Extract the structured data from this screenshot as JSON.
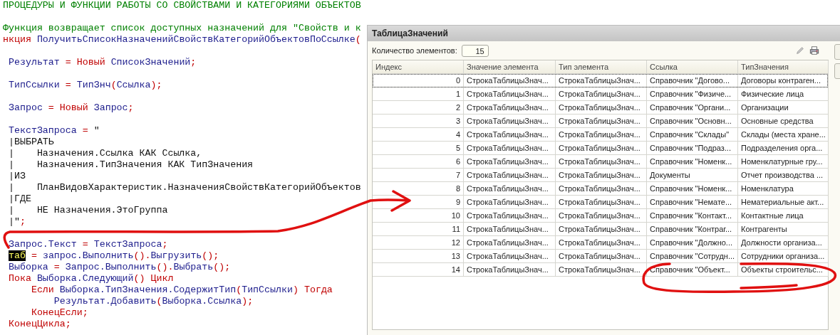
{
  "editor": {
    "lines": [
      {
        "kind": "code",
        "tokens": [
          {
            "kind": "comment",
            "text": "ПРОЦЕДУРЫ И ФУНКЦИИ РАБОТЫ СО СВОЙСТВАМИ И КАТЕГОРИЯМИ ОБЪЕКТОВ"
          }
        ]
      },
      {
        "kind": "blank"
      },
      {
        "kind": "code",
        "tokens": [
          {
            "kind": "comment",
            "text": "Функция возвращает список доступных назначений для \"Свойств и к"
          }
        ]
      },
      {
        "kind": "code",
        "tokens": [
          {
            "kind": "kw",
            "text": "нкция "
          },
          {
            "kind": "id",
            "text": "ПолучитьСписокНазначенийСвойствКатегорийОбъектовПоСсылке"
          },
          {
            "kind": "op",
            "text": "("
          }
        ]
      },
      {
        "kind": "blank"
      },
      {
        "kind": "code",
        "tokens": [
          {
            "kind": "id",
            "text": " Результат "
          },
          {
            "kind": "op",
            "text": "= "
          },
          {
            "kind": "kw",
            "text": "Новый "
          },
          {
            "kind": "id",
            "text": "СписокЗначений"
          },
          {
            "kind": "op",
            "text": ";"
          }
        ]
      },
      {
        "kind": "blank"
      },
      {
        "kind": "code",
        "tokens": [
          {
            "kind": "id",
            "text": " ТипСсылки "
          },
          {
            "kind": "op",
            "text": "= "
          },
          {
            "kind": "id",
            "text": "ТипЗнч"
          },
          {
            "kind": "op",
            "text": "("
          },
          {
            "kind": "id",
            "text": "Ссылка"
          },
          {
            "kind": "op",
            "text": ");"
          }
        ]
      },
      {
        "kind": "blank"
      },
      {
        "kind": "code",
        "tokens": [
          {
            "kind": "id",
            "text": " Запрос "
          },
          {
            "kind": "op",
            "text": "= "
          },
          {
            "kind": "kw",
            "text": "Новый "
          },
          {
            "kind": "id",
            "text": "Запрос"
          },
          {
            "kind": "op",
            "text": ";"
          }
        ]
      },
      {
        "kind": "blank"
      },
      {
        "kind": "code",
        "tokens": [
          {
            "kind": "id",
            "text": " ТекстЗапроса "
          },
          {
            "kind": "op",
            "text": "= "
          },
          {
            "kind": "str",
            "text": "\""
          }
        ]
      },
      {
        "kind": "code",
        "tokens": [
          {
            "kind": "str",
            "text": " |ВЫБРАТЬ"
          }
        ]
      },
      {
        "kind": "code",
        "tokens": [
          {
            "kind": "str",
            "text": " |    Назначения.Ссылка КАК Ссылка,"
          }
        ]
      },
      {
        "kind": "code",
        "tokens": [
          {
            "kind": "str",
            "text": " |    Назначения.ТипЗначения КАК ТипЗначения"
          }
        ]
      },
      {
        "kind": "code",
        "tokens": [
          {
            "kind": "str",
            "text": " |ИЗ"
          }
        ]
      },
      {
        "kind": "code",
        "tokens": [
          {
            "kind": "str",
            "text": " |    ПланВидовХарактеристик.НазначенияСвойствКатегорийОбъектов"
          }
        ]
      },
      {
        "kind": "code",
        "tokens": [
          {
            "kind": "str",
            "text": " |ГДЕ"
          }
        ]
      },
      {
        "kind": "code",
        "tokens": [
          {
            "kind": "str",
            "text": " |    НЕ Назначения.ЭтоГруппа"
          }
        ]
      },
      {
        "kind": "code",
        "tokens": [
          {
            "kind": "str",
            "text": " |\""
          },
          {
            "kind": "op",
            "text": ";"
          }
        ]
      },
      {
        "kind": "blank"
      },
      {
        "kind": "code",
        "tokens": [
          {
            "kind": "id",
            "text": " Запрос.Текст "
          },
          {
            "kind": "op",
            "text": "= "
          },
          {
            "kind": "id",
            "text": "ТекстЗапроса"
          },
          {
            "kind": "op",
            "text": ";"
          }
        ]
      },
      {
        "kind": "code",
        "tokens": [
          {
            "kind": "hl",
            "text": "таб"
          },
          {
            "kind": "op",
            "text": " = "
          },
          {
            "kind": "id",
            "text": "запрос.Выполнить"
          },
          {
            "kind": "op",
            "text": "()."
          },
          {
            "kind": "id",
            "text": "Выгрузить"
          },
          {
            "kind": "op",
            "text": "();"
          }
        ]
      },
      {
        "kind": "code",
        "tokens": [
          {
            "kind": "id",
            "text": " Выборка "
          },
          {
            "kind": "op",
            "text": "= "
          },
          {
            "kind": "id",
            "text": "Запрос.Выполнить"
          },
          {
            "kind": "op",
            "text": "()."
          },
          {
            "kind": "id",
            "text": "Выбрать"
          },
          {
            "kind": "op",
            "text": "();"
          }
        ]
      },
      {
        "kind": "code",
        "tokens": [
          {
            "kind": "kw",
            "text": " Пока "
          },
          {
            "kind": "id",
            "text": "Выборка.Следующий"
          },
          {
            "kind": "op",
            "text": "() "
          },
          {
            "kind": "kw",
            "text": "Цикл"
          }
        ]
      },
      {
        "kind": "code",
        "tokens": [
          {
            "kind": "kw",
            "text": "     Если "
          },
          {
            "kind": "id",
            "text": "Выборка.ТипЗначения.СодержитТип"
          },
          {
            "kind": "op",
            "text": "("
          },
          {
            "kind": "id",
            "text": "ТипСсылки"
          },
          {
            "kind": "op",
            "text": ") "
          },
          {
            "kind": "kw",
            "text": "Тогда"
          }
        ]
      },
      {
        "kind": "code",
        "tokens": [
          {
            "kind": "id",
            "text": "         Результат.Добавить"
          },
          {
            "kind": "op",
            "text": "("
          },
          {
            "kind": "id",
            "text": "Выборка.Ссылка"
          },
          {
            "kind": "op",
            "text": ");"
          }
        ]
      },
      {
        "kind": "code",
        "tokens": [
          {
            "kind": "kw",
            "text": "     КонецЕсли"
          },
          {
            "kind": "op",
            "text": ";"
          }
        ]
      },
      {
        "kind": "code",
        "tokens": [
          {
            "kind": "kw",
            "text": " КонецЦикла"
          },
          {
            "kind": "op",
            "text": ";"
          }
        ]
      }
    ]
  },
  "window": {
    "title": "ТаблицаЗначений",
    "count_label": "Количество элементов:",
    "count_value": "15",
    "table": {
      "columns": [
        "Индекс",
        "Значение элемента",
        "Тип элемента",
        "Ссылка",
        "ТипЗначения"
      ],
      "rows": [
        {
          "selected": true,
          "cells": [
            "0",
            "СтрокаТаблицыЗнач...",
            "СтрокаТаблицыЗнач...",
            "Справочник \"Догово...",
            "Договоры контраген..."
          ]
        },
        {
          "selected": false,
          "cells": [
            "1",
            "СтрокаТаблицыЗнач...",
            "СтрокаТаблицыЗнач...",
            "Справочник \"Физиче...",
            "Физические лица"
          ]
        },
        {
          "selected": false,
          "cells": [
            "2",
            "СтрокаТаблицыЗнач...",
            "СтрокаТаблицыЗнач...",
            "Справочник \"Органи...",
            "Организации"
          ]
        },
        {
          "selected": false,
          "cells": [
            "3",
            "СтрокаТаблицыЗнач...",
            "СтрокаТаблицыЗнач...",
            "Справочник \"Основн...",
            "Основные средства"
          ]
        },
        {
          "selected": false,
          "cells": [
            "4",
            "СтрокаТаблицыЗнач...",
            "СтрокаТаблицыЗнач...",
            "Справочник \"Склады\"",
            "Склады (места хране..."
          ]
        },
        {
          "selected": false,
          "cells": [
            "5",
            "СтрокаТаблицыЗнач...",
            "СтрокаТаблицыЗнач...",
            "Справочник \"Подраз...",
            "Подразделения орга..."
          ]
        },
        {
          "selected": false,
          "cells": [
            "6",
            "СтрокаТаблицыЗнач...",
            "СтрокаТаблицыЗнач...",
            "Справочник \"Номенк...",
            "Номенклатурные гру..."
          ]
        },
        {
          "selected": false,
          "cells": [
            "7",
            "СтрокаТаблицыЗнач...",
            "СтрокаТаблицыЗнач...",
            "Документы",
            "Отчет производства ..."
          ]
        },
        {
          "selected": false,
          "cells": [
            "8",
            "СтрокаТаблицыЗнач...",
            "СтрокаТаблицыЗнач...",
            "Справочник \"Номенк...",
            "Номенклатура"
          ]
        },
        {
          "selected": false,
          "cells": [
            "9",
            "СтрокаТаблицыЗнач...",
            "СтрокаТаблицыЗнач...",
            "Справочник \"Немате...",
            "Нематериальные акт..."
          ]
        },
        {
          "selected": false,
          "cells": [
            "10",
            "СтрокаТаблицыЗнач...",
            "СтрокаТаблицыЗнач...",
            "Справочник \"Контакт...",
            "Контактные лица"
          ]
        },
        {
          "selected": false,
          "cells": [
            "11",
            "СтрокаТаблицыЗнач...",
            "СтрокаТаблицыЗнач...",
            "Справочник \"Контраг...",
            "Контрагенты"
          ]
        },
        {
          "selected": false,
          "cells": [
            "12",
            "СтрокаТаблицыЗнач...",
            "СтрокаТаблицыЗнач...",
            "Справочник \"Должно...",
            "Должности организа..."
          ]
        },
        {
          "selected": false,
          "cells": [
            "13",
            "СтрокаТаблицыЗнач...",
            "СтрокаТаблицыЗнач...",
            "Справочник \"Сотрудн...",
            "Сотрудники организа..."
          ]
        },
        {
          "selected": false,
          "cells": [
            "14",
            "СтрокаТаблицыЗнач...",
            "СтрокаТаблицыЗнач...",
            "Справочник \"Объект...",
            "Объекты строительс..."
          ]
        }
      ]
    }
  }
}
